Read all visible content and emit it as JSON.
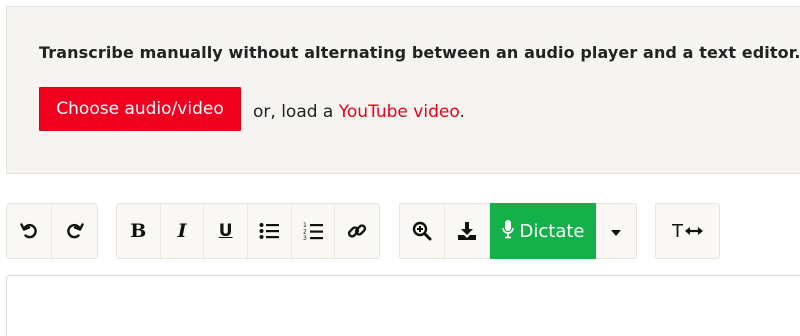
{
  "panel": {
    "headline": "Transcribe manually without alternating between an audio player and a text editor.",
    "choose_button": "Choose audio/video",
    "load_prefix": "or, load a ",
    "youtube_link": "YouTube video",
    "load_suffix": "."
  },
  "toolbar": {
    "history": [
      "undo-icon",
      "redo-icon"
    ],
    "format": {
      "bold": "B",
      "italic": "I",
      "underline": "U",
      "icons": [
        "bulleted-list-icon",
        "numbered-list-icon",
        "link-icon"
      ]
    },
    "tools": {
      "icons": [
        "zoom-in-icon",
        "download-icon"
      ],
      "dictate_label": "Dictate",
      "dictate_icon": "microphone-icon",
      "menu_icon": "caret-down-icon"
    },
    "text_width_label": "T"
  },
  "colors": {
    "accent_red": "#f0001f",
    "dictate_green": "#14b04a",
    "panel_bg": "#f6f4f0"
  }
}
